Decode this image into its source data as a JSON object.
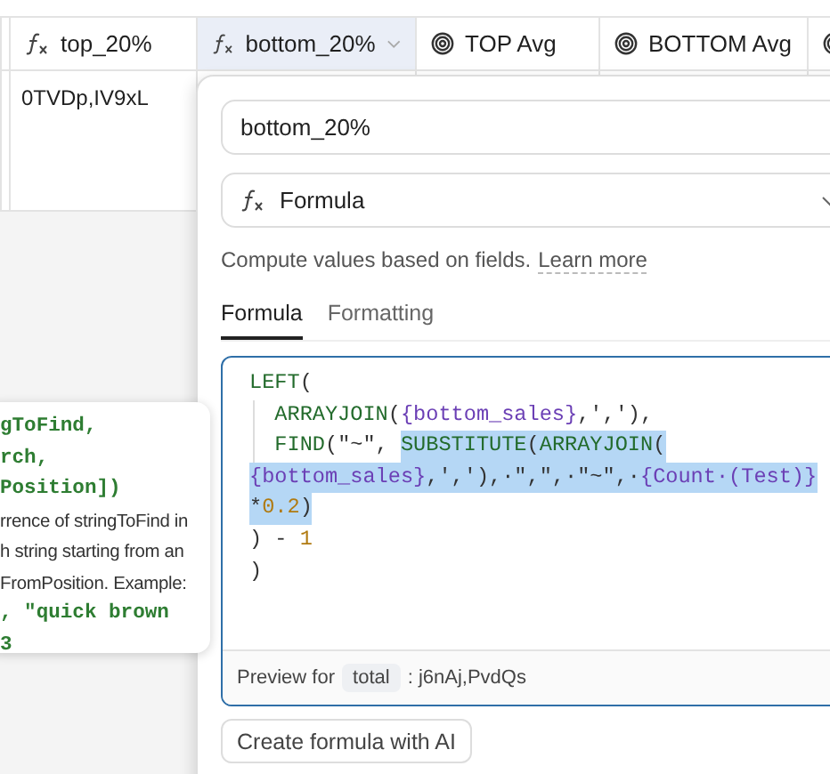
{
  "columns": [
    {
      "kind": "plain"
    },
    {
      "kind": "formula",
      "label": "top_20%",
      "selected": false
    },
    {
      "kind": "formula",
      "label": "bottom_20%",
      "selected": true
    },
    {
      "kind": "rollup",
      "label": "TOP Avg",
      "selected": false
    },
    {
      "kind": "rollup",
      "label": "BOTTOM Avg",
      "selected": false
    },
    {
      "kind": "rollup",
      "selected": false
    }
  ],
  "rows": [
    {
      "cells": [
        "",
        "0TVDp,IV9xL",
        "",
        "",
        "",
        ""
      ]
    }
  ],
  "tooltip": {
    "lines": [
      {
        "kind": "code",
        "text": "gToFind,"
      },
      {
        "kind": "code",
        "text": "rch,"
      },
      {
        "kind": "code",
        "text": "Position])"
      },
      {
        "kind": "prose",
        "text": "rrence of stringToFind in"
      },
      {
        "kind": "prose",
        "text": "h string starting from an"
      },
      {
        "kind": "prose",
        "text": "FromPosition. Example:"
      },
      {
        "kind": "code",
        "text": ", \"quick brown"
      },
      {
        "kind": "code",
        "text": "3"
      }
    ]
  },
  "panel": {
    "name_value": "bottom_20%",
    "type": {
      "label": "Formula"
    },
    "description": "Compute values based on fields.",
    "learn_more": "Learn more",
    "tabs": [
      {
        "label": "Formula",
        "selected": true
      },
      {
        "label": "Formatting",
        "selected": false
      }
    ],
    "code": [
      [
        {
          "kind": "func",
          "text": "LEFT",
          "selected": false
        },
        {
          "kind": "punct",
          "text": "(",
          "selected": false
        }
      ],
      [
        {
          "kind": "indent",
          "selected": false
        },
        {
          "kind": "func",
          "text": "ARRAYJOIN",
          "selected": false
        },
        {
          "kind": "punct",
          "text": "(",
          "selected": false
        },
        {
          "kind": "field",
          "text": "{bottom_sales}",
          "selected": false
        },
        {
          "kind": "punct",
          "text": ",','),",
          "selected": false
        }
      ],
      [
        {
          "kind": "indent",
          "selected": false
        },
        {
          "kind": "func",
          "text": "FIND",
          "selected": false
        },
        {
          "kind": "punct",
          "text": "(\"~\", ",
          "selected": false
        },
        {
          "kind": "func",
          "text": "SUBSTITUTE",
          "selected": true
        },
        {
          "kind": "punct",
          "text": "(",
          "selected": true
        },
        {
          "kind": "func",
          "text": "ARRAYJOIN",
          "selected": true
        },
        {
          "kind": "punct",
          "text": "(",
          "selected": true
        }
      ],
      [
        {
          "kind": "field",
          "text": "{bottom_sales}",
          "selected": true
        },
        {
          "kind": "punct",
          "text": ",','),·\",\",·\"~\",·",
          "selected": true
        },
        {
          "kind": "field",
          "text": "{Count·(Test)}",
          "selected": true
        }
      ],
      [
        {
          "kind": "punct",
          "text": "*",
          "selected": true
        },
        {
          "kind": "number",
          "text": "0.2",
          "selected": true
        },
        {
          "kind": "punct",
          "text": ")",
          "selected": true
        }
      ],
      [
        {
          "kind": "punct",
          "text": ") - ",
          "selected": false
        },
        {
          "kind": "number",
          "text": "1",
          "selected": false
        }
      ],
      [
        {
          "kind": "punct",
          "text": ")",
          "selected": false
        }
      ]
    ],
    "preview": {
      "label": "Preview for",
      "field": "total",
      "value": ": j6nAj,PvdQs"
    },
    "ai_button": "Create formula with AI"
  }
}
